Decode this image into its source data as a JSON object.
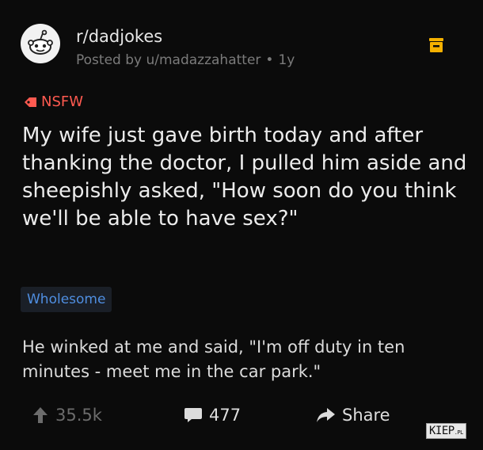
{
  "post": {
    "subreddit": "r/dadjokes",
    "posted_by_prefix": "Posted by",
    "author": "u/madazzahatter",
    "separator": "•",
    "age": "1y",
    "nsfw_label": "NSFW",
    "title": "My wife just gave birth today and after thanking the doctor, I pulled him aside and sheepishly asked, \"How soon do you think we'll be able to have sex?\"",
    "flair": "Wholesome",
    "body": "He winked at me and said, \"I'm off duty in ten minutes - meet me in the car park.\""
  },
  "actions": {
    "upvotes": "35.5k",
    "comments": "477",
    "share": "Share"
  },
  "watermark": {
    "main": "KIEP",
    "suffix": ".PL"
  },
  "icons": {
    "avatar": "reddit-snoo-icon",
    "save": "save-icon",
    "nsfw": "nsfw-diamond-icon",
    "upvote": "upvote-arrow-icon",
    "comment": "comment-bubble-icon",
    "share": "share-arrow-icon"
  },
  "colors": {
    "background": "#0b0b0b",
    "nsfw": "#ff5a50",
    "flair_text": "#4f8ee0",
    "flair_bg": "#1a1f27",
    "meta": "#7b7b7b"
  }
}
